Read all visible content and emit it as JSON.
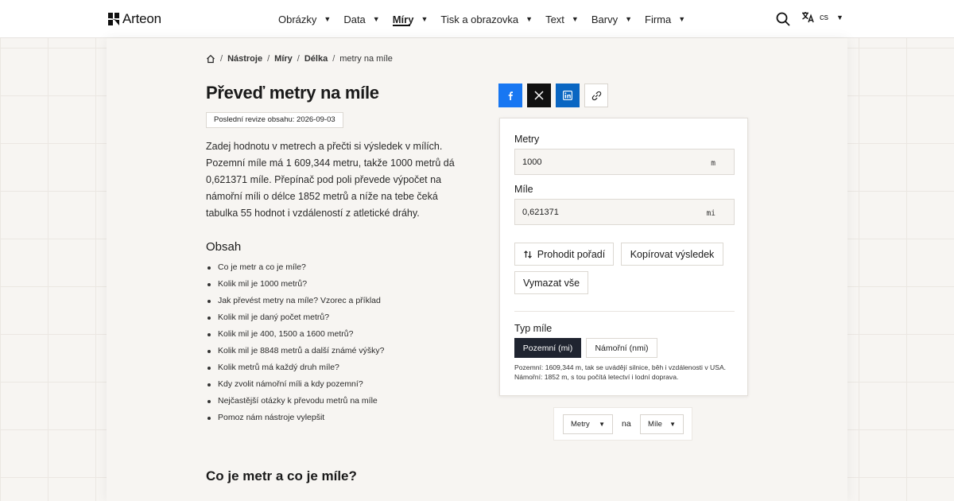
{
  "header": {
    "logo_text": "Arteon",
    "nav": [
      {
        "label": "Obrázky",
        "active": false
      },
      {
        "label": "Data",
        "active": false
      },
      {
        "label": "Míry",
        "active": true
      },
      {
        "label": "Tisk a obrazovka",
        "active": false
      },
      {
        "label": "Text",
        "active": false
      },
      {
        "label": "Barvy",
        "active": false
      },
      {
        "label": "Firma",
        "active": false
      }
    ],
    "nav_caret": "▼",
    "language_code": "cs",
    "icons": {
      "search": "search-icon",
      "language": "translate-icon"
    }
  },
  "breadcrumb": {
    "items": [
      "Nástroje",
      "Míry",
      "Délka"
    ],
    "current": "metry na míle",
    "separator": "/"
  },
  "page": {
    "title": "Převeď metry na míle",
    "revision": "Poslední revize obsahu: 2026-09-03",
    "intro": "Zadej hodnotu v metrech a přečti si výsledek v mílích. Pozemní míle má 1 609,344 metru, takže 1000 metrů dá 0,621371 míle. Přepínač pod poli převede výpočet na námořní míli o délce 1852 metrů a níže na tebe čeká tabulka 55 hodnot i vzdáleností z atletické dráhy.",
    "toc_title": "Obsah",
    "toc": [
      "Co je metr a co je míle?",
      "Kolik mil je 1000 metrů?",
      "Jak převést metry na míle? Vzorec a příklad",
      "Kolik mil je daný počet metrů?",
      "Kolik mil je 400, 1500 a 1600 metrů?",
      "Kolik mil je 8848 metrů a další známé výšky?",
      "Kolik metrů má každý druh míle?",
      "Kdy zvolit námořní míli a kdy pozemní?",
      "Nejčastější otázky k převodu metrů na míle",
      "Pomoz nám nástroje vylepšit"
    ],
    "section_title": "Co je metr a co je míle?"
  },
  "share": {
    "icons": [
      "facebook-icon",
      "x-icon",
      "linkedin-icon",
      "link-icon"
    ],
    "colors": {
      "facebook": "#1877f2",
      "x": "#111111",
      "linkedin": "#0a66c2"
    }
  },
  "converter": {
    "from_label": "Metry",
    "from_value": "1000",
    "from_unit": "m",
    "to_label": "Míle",
    "to_value": "0,621371",
    "to_unit": "mi",
    "swap_label": "Prohodit pořadí",
    "copy_label": "Kopírovat výsledek",
    "clear_label": "Vymazat vše",
    "type_label": "Typ míle",
    "type_options": [
      "Pozemní (mi)",
      "Námořní (nmi)"
    ],
    "type_selected": "Pozemní (mi)",
    "note": "Pozemní: 1609,344 m, tak se uvádějí silnice, běh i vzdálenosti v USA. Námořní: 1852 m, s tou počítá letectví i lodní doprava."
  },
  "switcher": {
    "from": "Metry",
    "joiner": "na",
    "to": "Míle",
    "caret": "▼"
  }
}
